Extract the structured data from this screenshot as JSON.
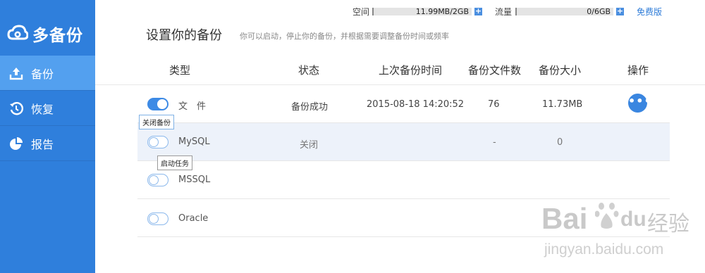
{
  "app": {
    "logo_text": "多备份"
  },
  "sidebar": {
    "items": [
      {
        "label": "备份",
        "icon": "upload-icon"
      },
      {
        "label": "恢复",
        "icon": "history-icon"
      },
      {
        "label": "报告",
        "icon": "pie-chart-icon"
      }
    ]
  },
  "topbar": {
    "space_label": "空间",
    "space_value": "11.99MB/2GB",
    "traffic_label": "流量",
    "traffic_value": "0/6GB",
    "plus_symbol": "+",
    "free_label": "免费版"
  },
  "page": {
    "title": "设置你的备份",
    "subtitle": "你可以启动，停止你的备份，并根据需要调整备份时间或频率"
  },
  "table": {
    "headers": [
      "类型",
      "状态",
      "上次备份时间",
      "备份文件数",
      "备份大小",
      "操作"
    ],
    "rows": [
      {
        "name": "文　件",
        "status": "备份成功",
        "last_time": "2015-08-18 14:20:52",
        "file_count": "76",
        "size": "11.73MB",
        "enabled": true,
        "has_ops": true
      },
      {
        "name": "MySQL",
        "status": "关闭",
        "last_time": "",
        "file_count": "-",
        "size": "0",
        "enabled": false,
        "has_ops": false
      },
      {
        "name": "MSSQL",
        "status": "",
        "last_time": "",
        "file_count": "",
        "size": "",
        "enabled": false,
        "has_ops": false
      },
      {
        "name": "Oracle",
        "status": "",
        "last_time": "",
        "file_count": "",
        "size": "",
        "enabled": false,
        "has_ops": false
      }
    ],
    "ops_symbol": "•••"
  },
  "tooltips": {
    "close_backup": "关闭备份",
    "start_task": "启动任务"
  },
  "watermark": {
    "brand": "Bai",
    "brand2": "du",
    "cn": "经验",
    "url": "jingyan.baidu.com"
  },
  "colors": {
    "sidebar": "#2f7fdc",
    "sidebar_active": "#53a0ef",
    "accent": "#3a86e0",
    "highlight_row": "#edf2fa"
  }
}
